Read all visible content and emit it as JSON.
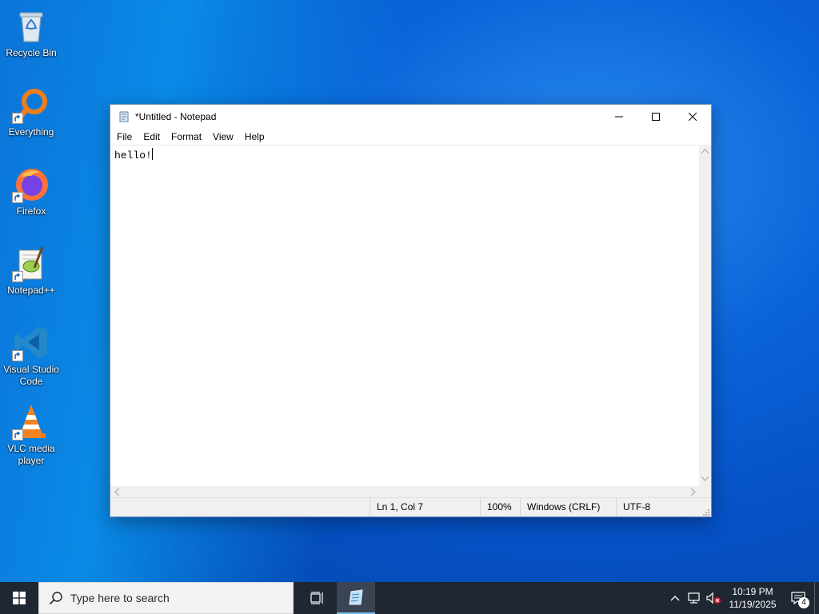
{
  "desktop": {
    "icons": [
      {
        "label": "Recycle Bin"
      },
      {
        "label": "Everything"
      },
      {
        "label": "Firefox"
      },
      {
        "label": "Notepad++"
      },
      {
        "label": "Visual Studio Code"
      },
      {
        "label": "VLC media player"
      }
    ]
  },
  "notepad": {
    "title": "*Untitled - Notepad",
    "menu": [
      "File",
      "Edit",
      "Format",
      "View",
      "Help"
    ],
    "content": "hello!",
    "status": {
      "position": "Ln 1, Col 7",
      "zoom": "100%",
      "line_ending": "Windows (CRLF)",
      "encoding": "UTF-8"
    }
  },
  "taskbar": {
    "search_placeholder": "Type here to search",
    "time": "10:19 PM",
    "date": "11/19/2025",
    "notification_count": "4"
  },
  "colors": {
    "accent": "#76b9ed",
    "taskbar_bg": "#1f2733",
    "desktop_blue": "#0a63d8"
  }
}
